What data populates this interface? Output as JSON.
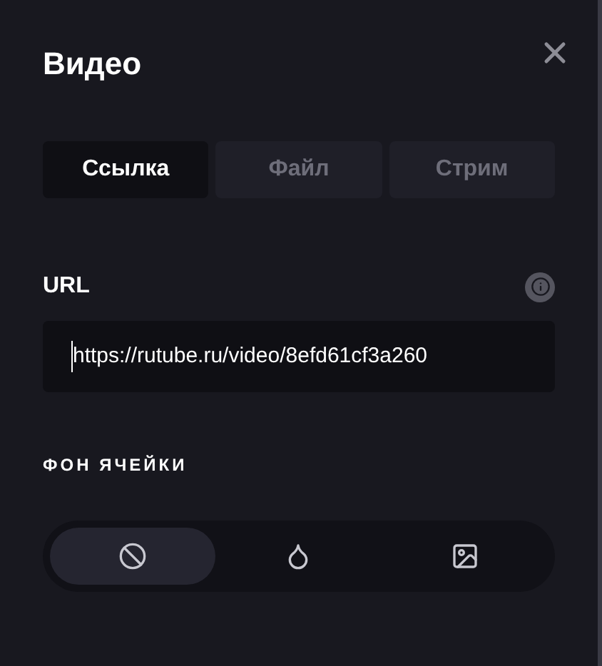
{
  "title": "Видео",
  "tabs": [
    {
      "label": "Ссылка",
      "selected": true
    },
    {
      "label": "Файл",
      "selected": false
    },
    {
      "label": "Стрим",
      "selected": false
    }
  ],
  "url": {
    "label": "URL",
    "value": "https://rutube.ru/video/8efd61cf3a260"
  },
  "cell_background": {
    "label": "ФОН ЯЧЕЙКИ",
    "options": [
      {
        "kind": "none",
        "selected": true
      },
      {
        "kind": "color",
        "selected": false
      },
      {
        "kind": "image",
        "selected": false
      }
    ]
  }
}
